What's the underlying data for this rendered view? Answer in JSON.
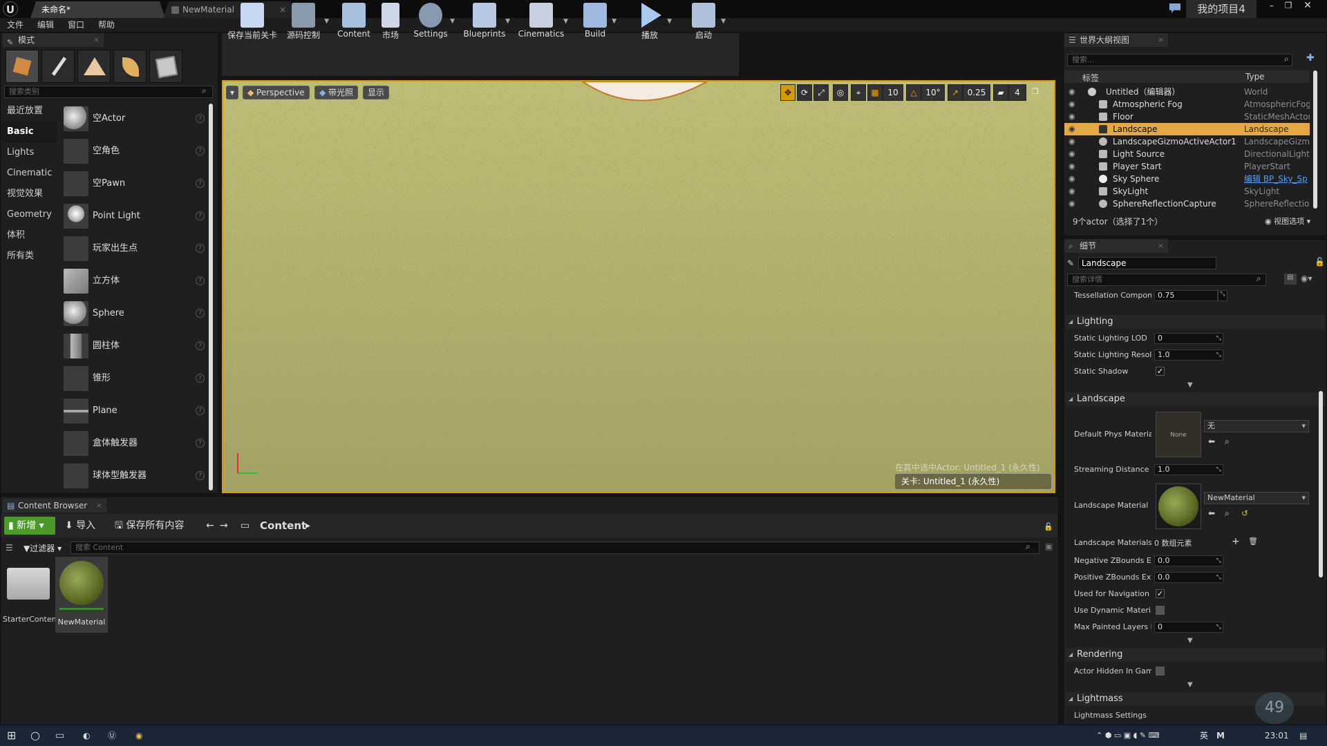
{
  "titlebar": {
    "active_tab": "未命名*",
    "inactive_tab": "NewMaterial",
    "project": "我的项目4"
  },
  "menu": [
    "文件",
    "编辑",
    "窗口",
    "帮助"
  ],
  "modes": {
    "tab": "模式",
    "search_placeholder": "搜索类别",
    "categories": [
      "最近放置",
      "Basic",
      "Lights",
      "Cinematic",
      "视觉效果",
      "Geometry",
      "体积",
      "所有类"
    ],
    "items": [
      "空Actor",
      "空角色",
      "空Pawn",
      "Point Light",
      "玩家出生点",
      "立方体",
      "Sphere",
      "圆柱体",
      "锥形",
      "Plane",
      "盒体触发器",
      "球体型触发器"
    ]
  },
  "toolbar": [
    "保存当前关卡",
    "源码控制",
    "Content",
    "市场",
    "Settings",
    "Blueprints",
    "Cinematics",
    "Build",
    "播放",
    "启动"
  ],
  "viewport": {
    "perspective": "Perspective",
    "lit": "带光照",
    "show": "显示",
    "grid_snap": "10",
    "rot_snap": "10°",
    "scale_snap": "0.25",
    "cam_speed": "4",
    "overlay_text": "在其中选中Actor: Untitled_1 (永久性)",
    "level_label": "关卡: Untitled_1 (永久性)"
  },
  "outliner": {
    "tab": "世界大纲视图",
    "search_placeholder": "搜索...",
    "col_label": "标签",
    "col_type": "Type",
    "rows": [
      {
        "name": "Untitled（编辑器）",
        "type": "World"
      },
      {
        "name": "Atmospheric Fog",
        "type": "AtmosphericFog"
      },
      {
        "name": "Floor",
        "type": "StaticMeshActor"
      },
      {
        "name": "Landscape",
        "type": "Landscape"
      },
      {
        "name": "LandscapeGizmoActiveActor1",
        "type": "LandscapeGizmo"
      },
      {
        "name": "Light Source",
        "type": "DirectionalLight"
      },
      {
        "name": "Player Start",
        "type": "PlayerStart"
      },
      {
        "name": "Sky Sphere",
        "type": "编辑 BP_Sky_Sp"
      },
      {
        "name": "SkyLight",
        "type": "SkyLight"
      },
      {
        "name": "SphereReflectionCapture",
        "type": "SphereReflectionC"
      }
    ],
    "footer": "9个actor（选择了1个）",
    "view_options": "视图选项"
  },
  "details": {
    "tab": "细节",
    "object_name": "Landscape",
    "search_placeholder": "搜索详情",
    "tess_label": "Tessellation Compone",
    "tess_val": "0.75",
    "lighting": "Lighting",
    "static_lod_label": "Static Lighting LOD",
    "static_lod_val": "0",
    "static_res_label": "Static Lighting Resolu",
    "static_res_val": "1.0",
    "static_shadow_label": "Static Shadow",
    "landscape": "Landscape",
    "phys_label": "Default Phys Material",
    "phys_thumb": "None",
    "phys_val": "无",
    "stream_label": "Streaming Distance M",
    "stream_val": "1.0",
    "mat_label": "Landscape Material",
    "mat_val": "NewMaterial",
    "mats_label": "Landscape Materials",
    "mats_val": "0 数组元素",
    "negz_label": "Negative ZBounds Ext",
    "negz_val": "0.0",
    "posz_label": "Positive ZBounds Exte",
    "posz_val": "0.0",
    "nav_label": "Used for Navigation",
    "dyn_label": "Use Dynamic Material",
    "maxp_label": "Max Painted Layers P",
    "maxp_val": "0",
    "rendering": "Rendering",
    "hidden_label": "Actor Hidden In Game",
    "lightmass": "Lightmass",
    "lm_settings": "Lightmass Settings",
    "fps": "49"
  },
  "content": {
    "tab": "Content Browser",
    "new": "新增",
    "import": "导入",
    "save_all": "保存所有内容",
    "path": "Content",
    "filter": "过滤器",
    "search_placeholder": "搜索 Content",
    "assets": [
      "StarterContent",
      "NewMaterial"
    ]
  },
  "taskbar": {
    "ime": "英",
    "ime2": "M",
    "time": "23:01"
  },
  "colors": {
    "accent": "#e2a846",
    "viewport_border": "#d69b00",
    "new_button": "#4a9a2a"
  }
}
